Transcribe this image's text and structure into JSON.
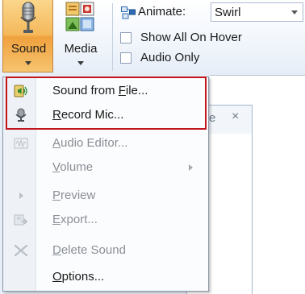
{
  "ribbon": {
    "sound_button": {
      "label": "Sound",
      "icon": "microphone-icon",
      "pressed": true,
      "accent": "#f4b95c"
    },
    "media_button": {
      "label": "Media",
      "icon": "media-icon"
    },
    "animate": {
      "label": "Animate:",
      "value": "Swirl",
      "icon": "animate-icon"
    },
    "checkboxes": [
      {
        "label": "Show All On Hover",
        "checked": false
      },
      {
        "label": "Audio Only",
        "checked": false
      }
    ]
  },
  "background_tab": {
    "char": "e",
    "close": "×"
  },
  "menu": {
    "items": [
      {
        "pre": "Sound from ",
        "key": "F",
        "post": "ile...",
        "icon": "speaker-icon",
        "enabled": true
      },
      {
        "pre": "",
        "key": "R",
        "post": "ecord Mic...",
        "icon": "microphone-icon",
        "enabled": true
      },
      {
        "pre": "",
        "key": "A",
        "post": "udio Editor...",
        "icon": "audio-editor-icon",
        "enabled": false
      },
      {
        "pre": "",
        "key": "V",
        "post": "olume",
        "icon": "",
        "enabled": false,
        "submenu": true
      },
      {
        "pre": "",
        "key": "P",
        "post": "review",
        "icon": "play-icon",
        "enabled": false
      },
      {
        "pre": "",
        "key": "E",
        "post": "xport...",
        "icon": "export-icon",
        "enabled": false
      },
      {
        "pre": "",
        "key": "D",
        "post": "elete Sound",
        "icon": "delete-icon",
        "enabled": false
      },
      {
        "pre": "",
        "key": "O",
        "post": "ptions...",
        "icon": "",
        "enabled": true
      }
    ]
  },
  "colors": {
    "highlight_border": "#c0151b",
    "disabled_text": "#8a8f96",
    "enabled_text": "#1a1a1a"
  }
}
